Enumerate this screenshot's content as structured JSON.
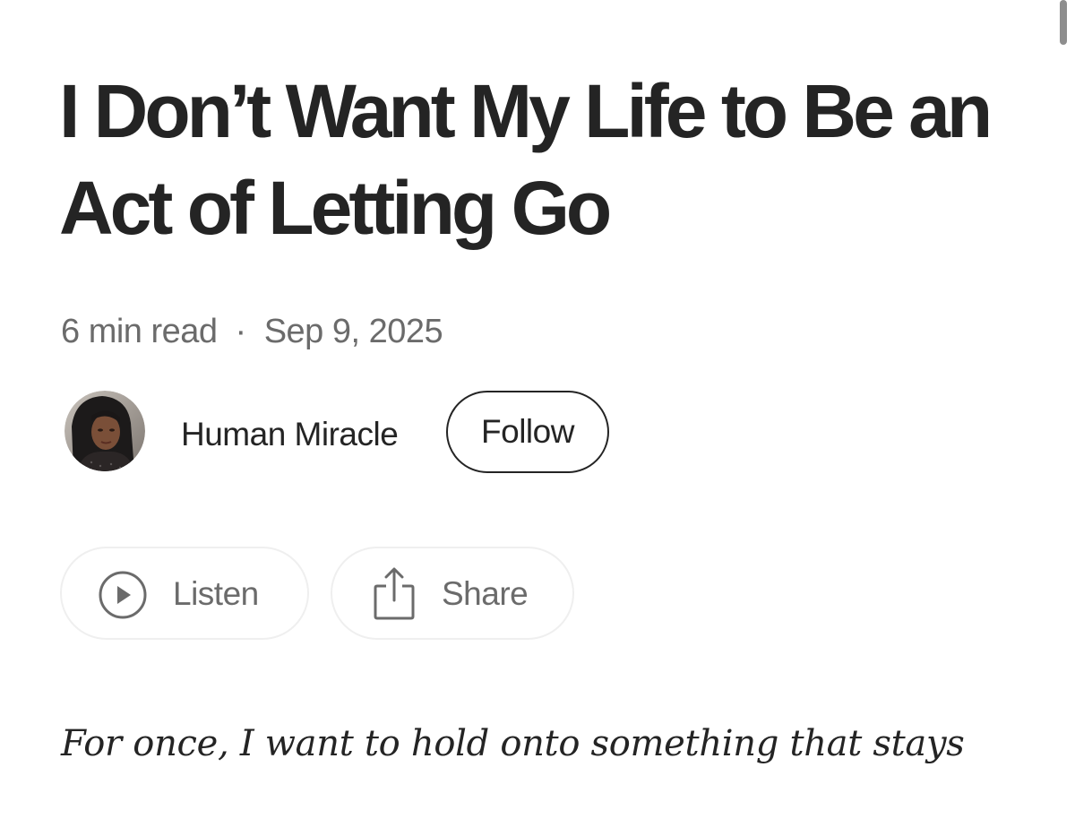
{
  "article": {
    "title": "I Don’t Want My Life to Be an Act of Letting Go",
    "read_time": "6 min read",
    "separator": "·",
    "date": "Sep 9, 2025",
    "subtitle": "For once, I want to hold onto something that stays"
  },
  "author": {
    "name": "Human Miracle",
    "avatar_icon": "author-avatar-photo",
    "follow_label": "Follow"
  },
  "actions": {
    "listen_label": "Listen",
    "listen_icon": "play-circle-icon",
    "share_label": "Share",
    "share_icon": "share-upload-icon"
  },
  "colors": {
    "text_primary": "#242424",
    "text_secondary": "#6b6b6b",
    "button_border_light": "#efefef",
    "background": "#ffffff"
  }
}
